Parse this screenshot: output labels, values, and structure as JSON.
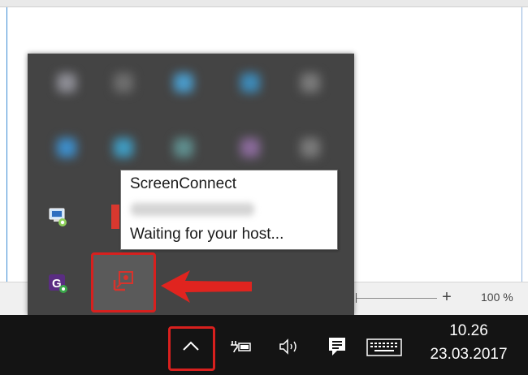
{
  "tooltip": {
    "app_name": "ScreenConnect",
    "status": "Waiting for your host..."
  },
  "status_bar": {
    "zoom_plus": "+",
    "zoom_level": "100 %"
  },
  "clock": {
    "time": "10.26",
    "date": "23.03.2017"
  },
  "icons": {
    "chevron": "chevron-up-icon",
    "power": "power-battery-icon",
    "volume": "speaker-volume-icon",
    "action_center": "action-center-icon",
    "keyboard": "touch-keyboard-icon",
    "screenconnect": "screenconnect-icon"
  },
  "colors": {
    "highlight": "#d8201e",
    "flyout_bg": "#444444",
    "taskbar_bg": "#141414"
  }
}
